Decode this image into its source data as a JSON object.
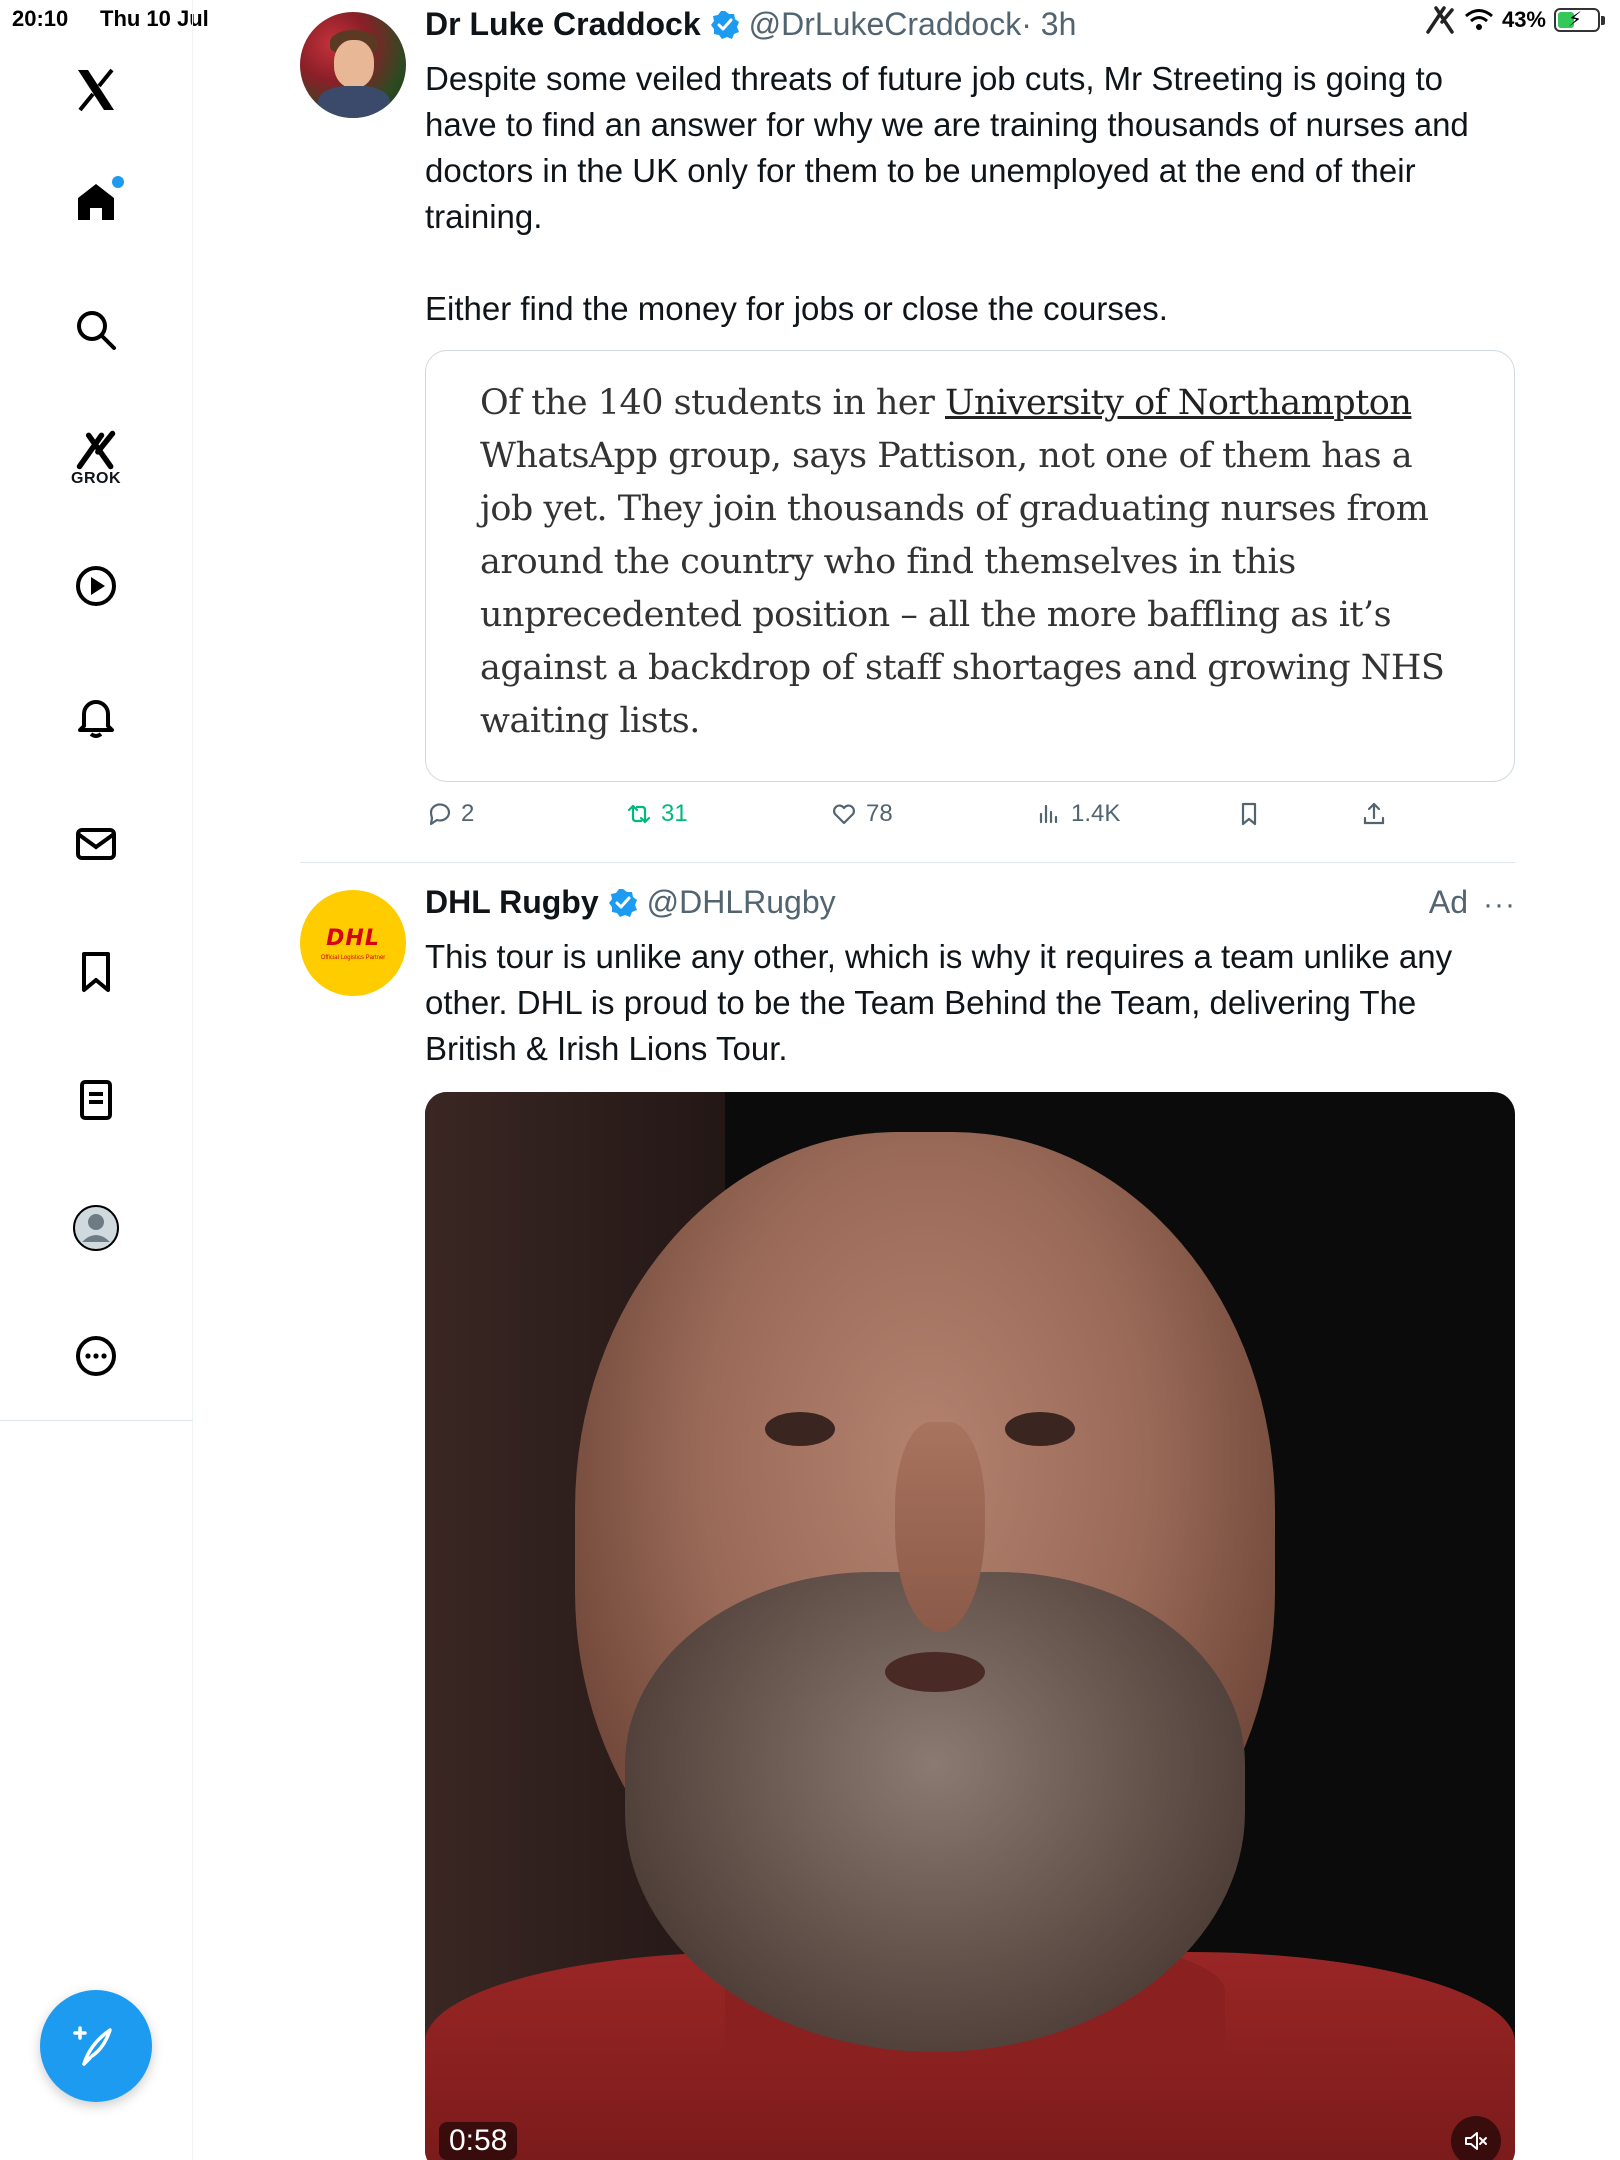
{
  "status_bar": {
    "time": "20:10",
    "date": "Thu 10 Jul",
    "battery_percent": "43%",
    "battery_level": 0.43,
    "icons": [
      "grok-app-icon",
      "wifi-icon",
      "battery-charging-icon"
    ]
  },
  "sidebar": {
    "logo": "x-logo-icon",
    "items": [
      {
        "icon": "home-icon",
        "label": "Home",
        "has_notification_dot": true
      },
      {
        "icon": "search-icon",
        "label": "Explore"
      },
      {
        "icon": "grok-icon",
        "label": "GROK"
      },
      {
        "icon": "video-play-icon",
        "label": "Video"
      },
      {
        "icon": "bell-icon",
        "label": "Notifications"
      },
      {
        "icon": "mail-icon",
        "label": "Messages"
      },
      {
        "icon": "bookmark-icon",
        "label": "Bookmarks"
      },
      {
        "icon": "list-icon",
        "label": "Lists"
      },
      {
        "icon": "profile-avatar-icon",
        "label": "Profile"
      },
      {
        "icon": "more-circle-icon",
        "label": "More"
      }
    ],
    "grok_label": "GROK",
    "compose_icon": "compose-post-icon"
  },
  "tweets": [
    {
      "author_name": "Dr Luke Craddock",
      "handle": "@DrLukeCraddock",
      "time": "· 3h",
      "verified": true,
      "text_lines": [
        "Despite some veiled threats of future job cuts, Mr Streeting is going to",
        "have to find an answer for why we are training thousands of nurses and",
        "doctors in the UK only for them to be unemployed at the end of their",
        "training."
      ],
      "text_line_2": "Either find the money for jobs or close the courses.",
      "quote": {
        "before_link": "Of the 140 students in her ",
        "link": "University of Northampton",
        "after_link": " WhatsApp group, says Pattison, not one of them has a job yet. They join thousands of graduating nurses from around the country who find themselves in this unprecedented position – all the more baffling as it’s against a backdrop of staff shortages and growing NHS waiting lists."
      },
      "actions": {
        "replies": "2",
        "reposts": "31",
        "likes": "78",
        "views": "1.4K"
      }
    },
    {
      "author_name": "DHL Rugby",
      "handle": "@DHLRugby",
      "verified": true,
      "ad_label": "Ad",
      "avatar_logo": "DHL",
      "avatar_tagline": "Official Logistics Partner",
      "text_lines": [
        "This tour is unlike any other, which is why it requires a team unlike any",
        "other. DHL is proud to be the Team Behind the Team, delivering The",
        "British & Irish Lions Tour."
      ],
      "video": {
        "duration": "0:58",
        "muted": true
      }
    }
  ],
  "colors": {
    "accent": "#1d9bf0",
    "repost_green": "#00ba7c",
    "secondary_text": "#536471",
    "dhl_yellow": "#ffcc00",
    "dhl_red": "#d40511"
  }
}
